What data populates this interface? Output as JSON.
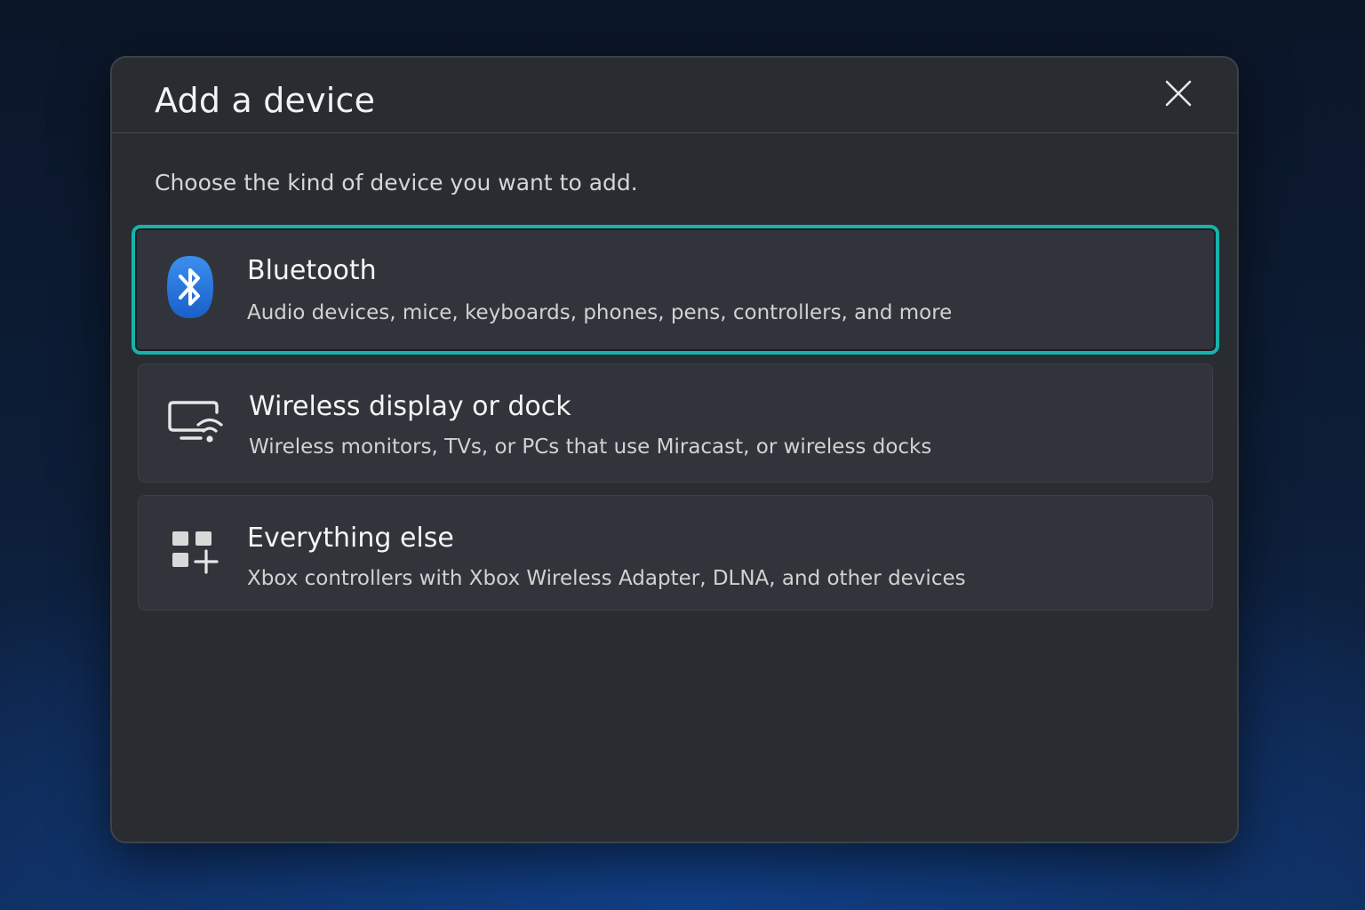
{
  "dialog": {
    "title": "Add a device",
    "instruction": "Choose the kind of device you want to add."
  },
  "options": [
    {
      "title": "Bluetooth",
      "description": "Audio devices, mice, keyboards, phones, pens, controllers, and more",
      "icon": "bluetooth-icon",
      "selected": true
    },
    {
      "title": "Wireless display or dock",
      "description": "Wireless monitors, TVs, or PCs that use Miracast, or wireless docks",
      "icon": "wireless-display-icon",
      "selected": false
    },
    {
      "title": "Everything else",
      "description": "Xbox controllers with Xbox Wireless Adapter, DLNA, and other devices",
      "icon": "add-apps-icon",
      "selected": false
    }
  ],
  "colors": {
    "accent": "#16b3ad",
    "bluetooth": "#1f74d8",
    "dialog_bg": "#292c31",
    "option_bg": "#31343a"
  }
}
